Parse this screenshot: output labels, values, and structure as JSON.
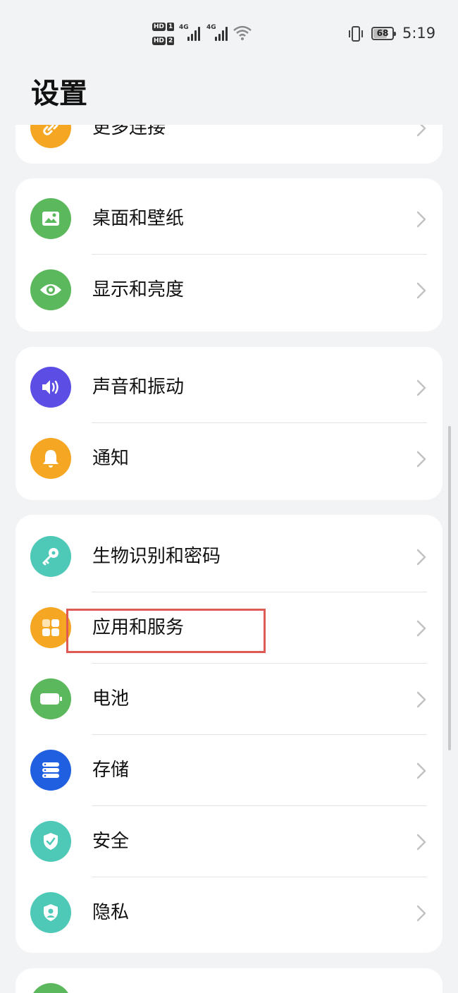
{
  "status_bar": {
    "hd1": "HD",
    "sim1": "1",
    "hd2": "HD",
    "sim2": "2",
    "net1": "4G",
    "net2": "4G",
    "battery": "68",
    "time": "5:19"
  },
  "page": {
    "title": "设置"
  },
  "cards": [
    {
      "items": [
        {
          "label": "更多连接",
          "icon": "link-icon",
          "color": "#f5a623"
        }
      ]
    },
    {
      "items": [
        {
          "label": "桌面和壁纸",
          "icon": "image-icon",
          "color": "#5cb85c"
        },
        {
          "label": "显示和亮度",
          "icon": "eye-icon",
          "color": "#5cb85c"
        }
      ]
    },
    {
      "items": [
        {
          "label": "声音和振动",
          "icon": "speaker-icon",
          "color": "#5c4ee5"
        },
        {
          "label": "通知",
          "icon": "bell-icon",
          "color": "#f5a623"
        }
      ]
    },
    {
      "items": [
        {
          "label": "生物识别和密码",
          "icon": "key-icon",
          "color": "#4ec9b8"
        },
        {
          "label": "应用和服务",
          "icon": "apps-grid-icon",
          "color": "#f5a623"
        },
        {
          "label": "电池",
          "icon": "battery-icon",
          "color": "#5cb85c"
        },
        {
          "label": "存储",
          "icon": "storage-icon",
          "color": "#1f5fe0"
        },
        {
          "label": "安全",
          "icon": "shield-check-icon",
          "color": "#4ec9b8"
        },
        {
          "label": "隐私",
          "icon": "privacy-shield-icon",
          "color": "#4ec9b8"
        }
      ]
    },
    {
      "items": [
        {
          "label": "",
          "icon": "partial-icon",
          "color": "#5cb85c"
        }
      ]
    }
  ],
  "highlight": {
    "color": "#e05a55"
  }
}
